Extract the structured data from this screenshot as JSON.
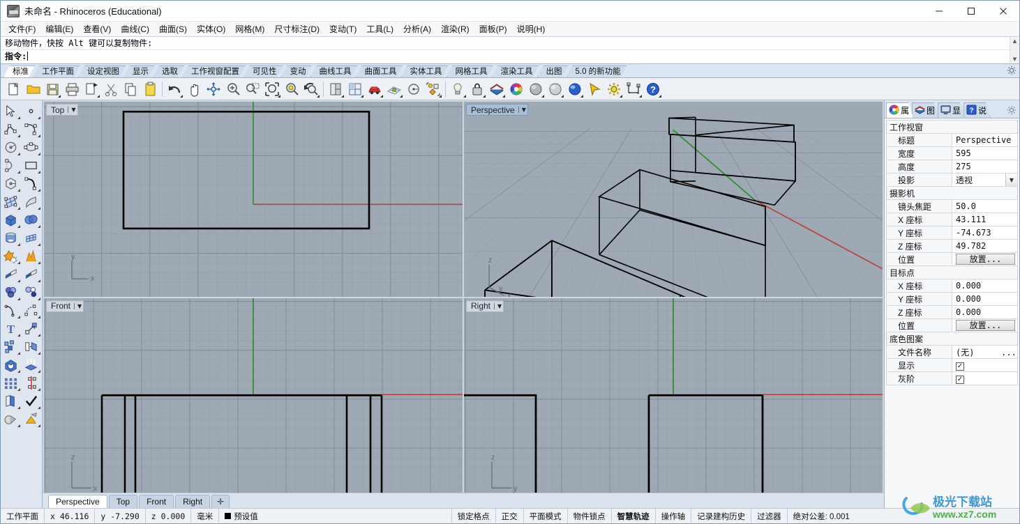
{
  "window": {
    "title": "未命名 - Rhinoceros (Educational)",
    "icon": "rhino-app-icon",
    "minimize": "—",
    "maximize": "☐",
    "close": "✕"
  },
  "menubar": [
    {
      "label": "文件(F)",
      "name": "menu-file"
    },
    {
      "label": "编辑(E)",
      "name": "menu-edit"
    },
    {
      "label": "查看(V)",
      "name": "menu-view"
    },
    {
      "label": "曲线(C)",
      "name": "menu-curve"
    },
    {
      "label": "曲面(S)",
      "name": "menu-surface"
    },
    {
      "label": "实体(O)",
      "name": "menu-solid"
    },
    {
      "label": "网格(M)",
      "name": "menu-mesh"
    },
    {
      "label": "尺寸标注(D)",
      "name": "menu-dimension"
    },
    {
      "label": "变动(T)",
      "name": "menu-transform"
    },
    {
      "label": "工具(L)",
      "name": "menu-tools"
    },
    {
      "label": "分析(A)",
      "name": "menu-analyze"
    },
    {
      "label": "渲染(R)",
      "name": "menu-render"
    },
    {
      "label": "面板(P)",
      "name": "menu-panels"
    },
    {
      "label": "说明(H)",
      "name": "menu-help"
    }
  ],
  "command": {
    "history": "移动物件，快按 Alt 键可以复制物件:",
    "prompt_label": "指令:",
    "prompt_value": ""
  },
  "toolbar_tabs": [
    {
      "label": "标准",
      "active": true
    },
    {
      "label": "工作平面",
      "active": false
    },
    {
      "label": "设定视图",
      "active": false
    },
    {
      "label": "显示",
      "active": false
    },
    {
      "label": "选取",
      "active": false
    },
    {
      "label": "工作视窗配置",
      "active": false
    },
    {
      "label": "可见性",
      "active": false
    },
    {
      "label": "变动",
      "active": false
    },
    {
      "label": "曲线工具",
      "active": false
    },
    {
      "label": "曲面工具",
      "active": false
    },
    {
      "label": "实体工具",
      "active": false
    },
    {
      "label": "网格工具",
      "active": false
    },
    {
      "label": "渲染工具",
      "active": false
    },
    {
      "label": "出图",
      "active": false
    },
    {
      "label": "5.0 的新功能",
      "active": false
    }
  ],
  "main_toolbar": [
    {
      "name": "new-file-icon",
      "flyout": false
    },
    {
      "name": "open-file-icon",
      "flyout": false
    },
    {
      "name": "save-file-icon",
      "flyout": true
    },
    {
      "name": "print-icon",
      "flyout": false
    },
    {
      "name": "copy-to-clipboard-icon",
      "flyout": true
    },
    {
      "name": "cut-icon",
      "flyout": false
    },
    {
      "name": "copy-icon",
      "flyout": false
    },
    {
      "name": "paste-icon",
      "flyout": false
    },
    {
      "name": "undo-icon",
      "flyout": true
    },
    {
      "name": "pan-hand-icon",
      "flyout": false
    },
    {
      "name": "rotate-view-icon",
      "flyout": false
    },
    {
      "name": "zoom-in-icon",
      "flyout": false
    },
    {
      "name": "zoom-window-icon",
      "flyout": false
    },
    {
      "name": "zoom-extents-icon",
      "flyout": true
    },
    {
      "name": "zoom-selected-icon",
      "flyout": false
    },
    {
      "name": "zoom-previous-icon",
      "flyout": true
    },
    {
      "name": "viewport-layout-icon",
      "flyout": true
    },
    {
      "name": "four-view-icon",
      "flyout": true
    },
    {
      "name": "car-render-icon",
      "flyout": true
    },
    {
      "name": "grid-snap-icon",
      "flyout": true
    },
    {
      "name": "osnap-circle-icon",
      "flyout": false
    },
    {
      "name": "object-properties-icon",
      "flyout": true
    },
    {
      "name": "light-bulb-icon",
      "flyout": true
    },
    {
      "name": "lock-icon",
      "flyout": true
    },
    {
      "name": "layer-icon",
      "flyout": true
    },
    {
      "name": "color-wheel-icon",
      "flyout": false
    },
    {
      "name": "shaded-sphere-icon",
      "flyout": true
    },
    {
      "name": "ghosted-sphere-icon",
      "flyout": true
    },
    {
      "name": "rendered-sphere-icon",
      "flyout": true
    },
    {
      "name": "select-arrow-icon",
      "flyout": false
    },
    {
      "name": "options-gear-icon",
      "flyout": true
    },
    {
      "name": "dimension-icon",
      "flyout": true
    },
    {
      "name": "help-icon",
      "flyout": true
    }
  ],
  "left_toolbar": [
    [
      "select-objects-icon",
      "point-icon"
    ],
    [
      "polyline-icon",
      "curve-interp-icon"
    ],
    [
      "circle-icon",
      "ellipse-icon"
    ],
    [
      "arc-icon",
      "rectangle-icon"
    ],
    [
      "polygon-icon",
      "curve-blend-icon"
    ],
    [
      "surface-from-points-icon",
      "surface-extrude-icon"
    ],
    [
      "box-solid-icon",
      "sphere-boolean-icon"
    ],
    [
      "cylinder-icon",
      "surface-mesh-icon"
    ],
    [
      "explode-star-icon",
      "fillet-icon"
    ],
    [
      "trim-icon",
      "split-icon"
    ],
    [
      "boolean-union-icon",
      "boolean-difference-icon"
    ],
    [
      "fillet-curve-icon",
      "chamfer-icon"
    ],
    [
      "text-tool-icon",
      "scale-icon"
    ],
    [
      "array-icon",
      "mirror-icon"
    ],
    [
      "cap-solid-icon",
      "extrude-up-icon"
    ],
    [
      "grid-array-icon",
      "align-icon"
    ],
    [
      "layers-stack-icon",
      "check-object-icon"
    ],
    [
      "render-shadow-icon",
      "render-paint-icon"
    ]
  ],
  "viewports": [
    {
      "title": "Top",
      "active": false,
      "axis_labels": [
        "y",
        "x"
      ]
    },
    {
      "title": "Perspective",
      "active": true,
      "axis_labels": [
        "z",
        "y",
        "x"
      ]
    },
    {
      "title": "Front",
      "active": false,
      "axis_labels": [
        "z",
        "x"
      ]
    },
    {
      "title": "Right",
      "active": false,
      "axis_labels": [
        "z",
        "y"
      ]
    }
  ],
  "viewport_tabs": [
    {
      "label": "Perspective",
      "active": true
    },
    {
      "label": "Top",
      "active": false
    },
    {
      "label": "Front",
      "active": false
    },
    {
      "label": "Right",
      "active": false
    },
    {
      "label": "✛",
      "active": false
    }
  ],
  "properties_panel": {
    "tabs": [
      {
        "label": "属",
        "icon": "color-wheel-icon",
        "active": true
      },
      {
        "label": "图",
        "icon": "layer-icon",
        "active": false
      },
      {
        "label": "显",
        "icon": "display-monitor-icon",
        "active": false
      },
      {
        "label": "说",
        "icon": "help-question-icon",
        "active": false
      }
    ],
    "sections": [
      {
        "title": "工作视窗",
        "rows": [
          {
            "label": "标题",
            "value": "Perspective",
            "type": "text"
          },
          {
            "label": "宽度",
            "value": "595",
            "type": "text"
          },
          {
            "label": "高度",
            "value": "275",
            "type": "text"
          },
          {
            "label": "投影",
            "value": "透视",
            "type": "combo"
          }
        ]
      },
      {
        "title": "摄影机",
        "rows": [
          {
            "label": "镜头焦距",
            "value": "50.0",
            "type": "text"
          },
          {
            "label": "X 座标",
            "value": "43.111",
            "type": "text"
          },
          {
            "label": "Y 座标",
            "value": "-74.673",
            "type": "text"
          },
          {
            "label": "Z 座标",
            "value": "49.782",
            "type": "text"
          },
          {
            "label": "位置",
            "value": "放置...",
            "type": "button"
          }
        ]
      },
      {
        "title": "目标点",
        "rows": [
          {
            "label": "X 座标",
            "value": "0.000",
            "type": "text"
          },
          {
            "label": "Y 座标",
            "value": "0.000",
            "type": "text"
          },
          {
            "label": "Z 座标",
            "value": "0.000",
            "type": "text"
          },
          {
            "label": "位置",
            "value": "放置...",
            "type": "button"
          }
        ]
      },
      {
        "title": "底色图案",
        "rows": [
          {
            "label": "文件名称",
            "value": "(无)",
            "type": "file"
          },
          {
            "label": "显示",
            "value": "✓",
            "type": "checkbox"
          },
          {
            "label": "灰阶",
            "value": "✓",
            "type": "checkbox"
          }
        ]
      }
    ]
  },
  "statusbar": [
    {
      "label": "工作平面",
      "name": "cplane-cell",
      "cjk": true,
      "bold": false
    },
    {
      "label": "x 46.116",
      "name": "x-coordinate-cell",
      "cjk": false,
      "bold": false
    },
    {
      "label": "y -7.290",
      "name": "y-coordinate-cell",
      "cjk": false,
      "bold": false
    },
    {
      "label": "z 0.000",
      "name": "z-coordinate-cell",
      "cjk": false,
      "bold": false
    },
    {
      "label": "毫米",
      "name": "units-cell",
      "cjk": true,
      "bold": false
    },
    {
      "label": "预设值",
      "name": "layer-cell",
      "cjk": true,
      "bold": false,
      "swatch": "#000000"
    },
    {
      "label": "锁定格点",
      "name": "grid-snap-toggle",
      "cjk": true,
      "bold": false
    },
    {
      "label": "正交",
      "name": "ortho-toggle",
      "cjk": true,
      "bold": false
    },
    {
      "label": "平面模式",
      "name": "planar-toggle",
      "cjk": true,
      "bold": false
    },
    {
      "label": "物件锁点",
      "name": "osnap-toggle",
      "cjk": true,
      "bold": false
    },
    {
      "label": "智慧轨迹",
      "name": "smarttrack-toggle",
      "cjk": true,
      "bold": true
    },
    {
      "label": "操作轴",
      "name": "gumball-toggle",
      "cjk": true,
      "bold": false
    },
    {
      "label": "记录建构历史",
      "name": "record-history-toggle",
      "cjk": true,
      "bold": false
    },
    {
      "label": "过滤器",
      "name": "filter-toggle",
      "cjk": true,
      "bold": false
    },
    {
      "label": "绝对公差: 0.001",
      "name": "tolerance-cell",
      "cjk": true,
      "bold": false
    }
  ],
  "watermark": {
    "title": "极光下载站",
    "url": "www.xz7.com"
  },
  "colors": {
    "viewport_bg": "#9ea9b4",
    "grid_minor": "#93a0ac",
    "grid_major": "#7e8b98",
    "axis_x": "#b5453c",
    "axis_y": "#2e8b2e",
    "object_line": "#000000",
    "accent_tab": "#a8bdd6"
  }
}
